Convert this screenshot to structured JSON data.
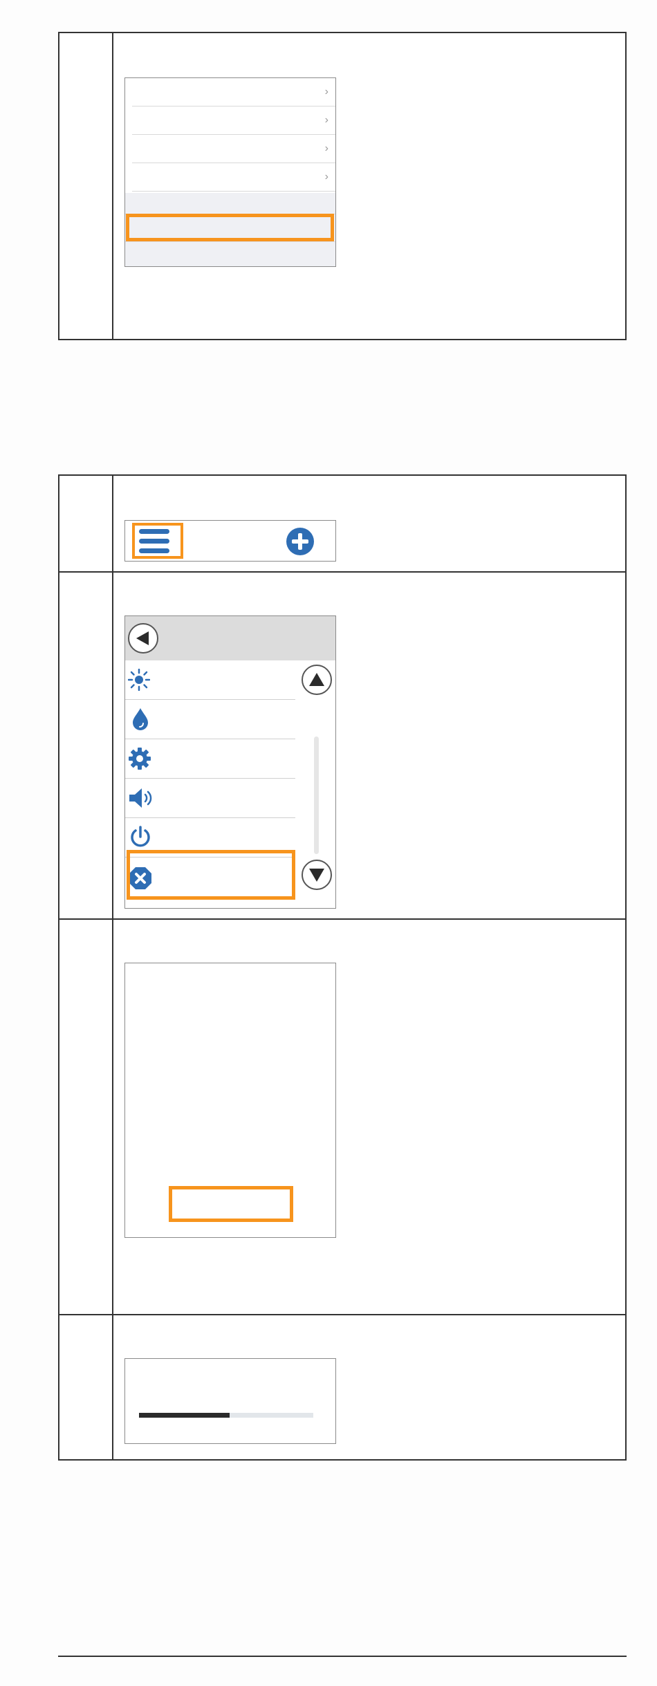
{
  "doc": {
    "accent_color": "#f7941d",
    "icon_color": "#2e6db4"
  },
  "step_a": {
    "menu_rows": [
      {
        "chevron": "›"
      },
      {
        "chevron": "›"
      },
      {
        "chevron": "›"
      },
      {
        "chevron": "›"
      }
    ]
  },
  "step_b": {
    "header": {
      "menu_icon": "hamburger-icon",
      "add_icon": "plus-circle-icon"
    },
    "list": {
      "back_icon": "back-arrow-icon",
      "items": [
        {
          "icon": "sun-icon"
        },
        {
          "icon": "water-drop-icon"
        },
        {
          "icon": "gear-icon"
        },
        {
          "icon": "speaker-icon"
        },
        {
          "icon": "power-icon"
        },
        {
          "icon": "close-circle-icon"
        }
      ],
      "scroll_up_icon": "triangle-up-icon",
      "scroll_down_icon": "triangle-down-icon"
    },
    "progress": {
      "value": 0.52
    }
  }
}
